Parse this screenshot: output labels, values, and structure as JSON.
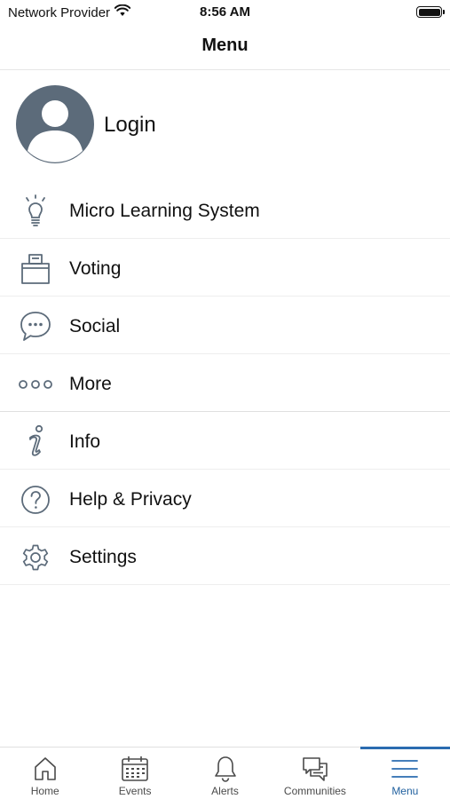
{
  "status_bar": {
    "carrier": "Network Provider",
    "time": "8:56 AM"
  },
  "nav": {
    "title": "Menu"
  },
  "profile": {
    "login_label": "Login"
  },
  "menu": {
    "items": [
      {
        "label": "Micro Learning System",
        "icon": "lightbulb-icon"
      },
      {
        "label": "Voting",
        "icon": "ballot-box-icon"
      },
      {
        "label": "Social",
        "icon": "chat-bubble-icon"
      },
      {
        "label": "More",
        "icon": "more-dots-icon"
      },
      {
        "label": "Info",
        "icon": "info-icon"
      },
      {
        "label": "Help & Privacy",
        "icon": "help-icon"
      },
      {
        "label": "Settings",
        "icon": "gear-icon"
      }
    ]
  },
  "tab_bar": {
    "tabs": [
      {
        "label": "Home",
        "icon": "home-icon"
      },
      {
        "label": "Events",
        "icon": "calendar-icon"
      },
      {
        "label": "Alerts",
        "icon": "bell-icon"
      },
      {
        "label": "Communities",
        "icon": "chat-bubbles-icon"
      },
      {
        "label": "Menu",
        "icon": "hamburger-icon"
      }
    ],
    "active": "Menu"
  },
  "colors": {
    "icon": "#5c6b7a",
    "avatar": "#5c6b7a",
    "accent": "#2b6cb0"
  }
}
